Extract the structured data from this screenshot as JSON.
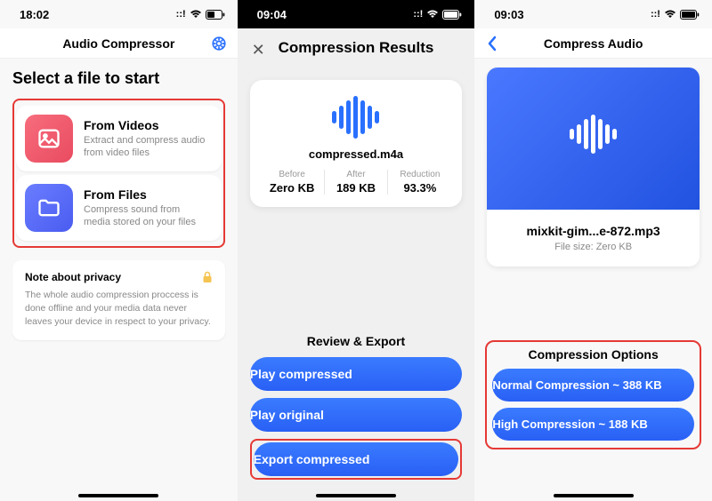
{
  "screen1": {
    "time": "18:02",
    "nav_title": "Audio Compressor",
    "heading": "Select a file to start",
    "opt1": {
      "title": "From Videos",
      "sub": "Extract and compress audio from video files"
    },
    "opt2": {
      "title": "From Files",
      "sub": "Compress sound from media stored on your files"
    },
    "privacy": {
      "title": "Note about privacy",
      "body": "The whole audio compression proccess is done offline and your media data never leaves your device in respect to your privacy."
    }
  },
  "screen2": {
    "time": "09:04",
    "title": "Compression Results",
    "file": "compressed.m4a",
    "before_label": "Before",
    "before_val": "Zero KB",
    "after_label": "After",
    "after_val": "189 KB",
    "reduction_label": "Reduction",
    "reduction_val": "93.3%",
    "review_head": "Review & Export",
    "btn_play_comp": "Play compressed",
    "btn_play_orig": "Play original",
    "btn_export": "Export compressed"
  },
  "screen3": {
    "time": "09:03",
    "nav_title": "Compress Audio",
    "file": "mixkit-gim...e-872.mp3",
    "file_size": "File size: Zero KB",
    "opts_head": "Compression Options",
    "btn_normal": "Normal Compression ~ 388 KB",
    "btn_high": "High Compression ~ 188 KB"
  }
}
